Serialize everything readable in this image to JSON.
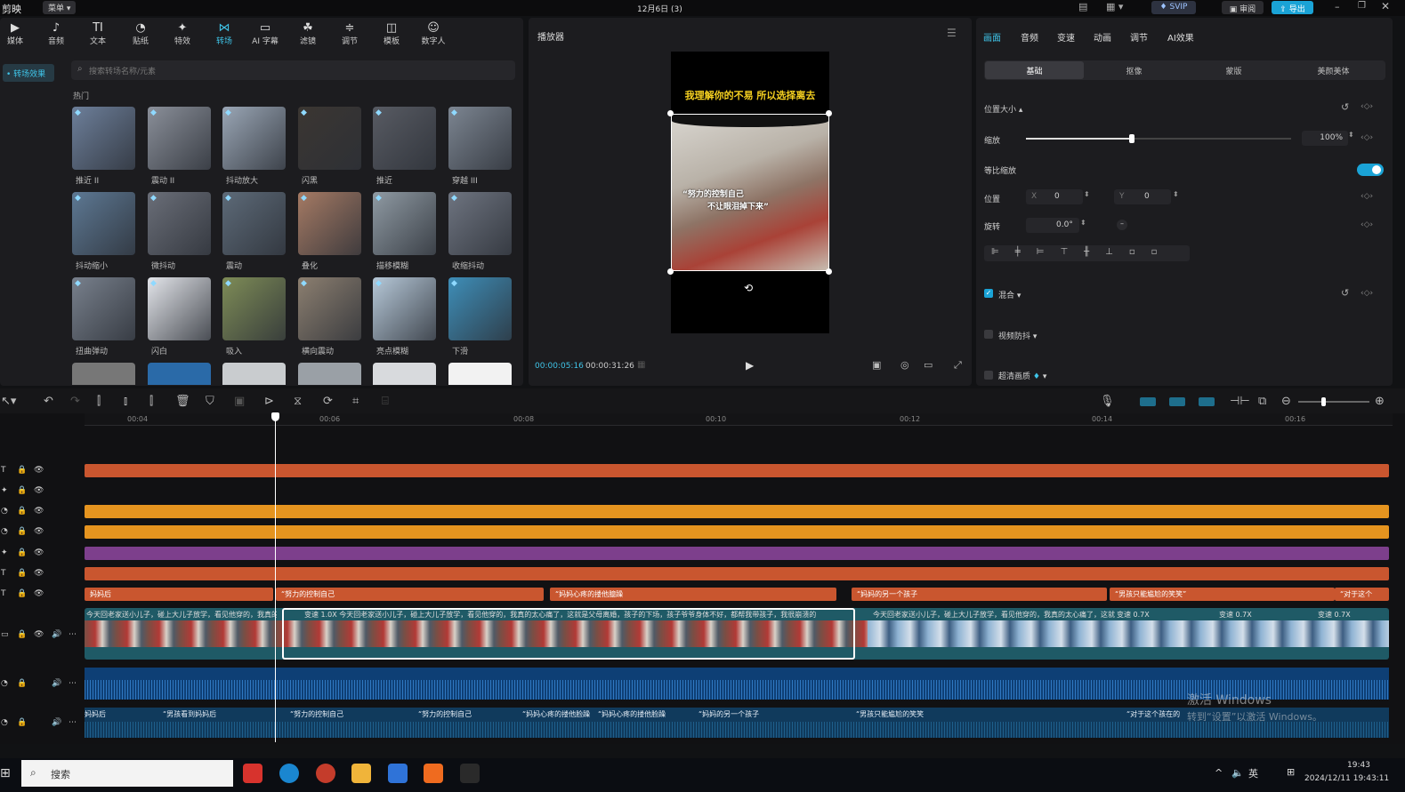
{
  "app": {
    "title": "剪映",
    "menu": "菜单",
    "project_title": "12月6日 (3)",
    "svip": "SVIP",
    "review": "审阅",
    "export": "导出"
  },
  "top_tabs": [
    {
      "label": "媒体",
      "icon": "▶"
    },
    {
      "label": "音频",
      "icon": "♪"
    },
    {
      "label": "文本",
      "icon": "TI"
    },
    {
      "label": "贴纸",
      "icon": "◔"
    },
    {
      "label": "特效",
      "icon": "✦"
    },
    {
      "label": "转场",
      "icon": "⋈"
    },
    {
      "label": "AI 字幕",
      "icon": "▭"
    },
    {
      "label": "滤镜",
      "icon": "☘"
    },
    {
      "label": "调节",
      "icon": "≑"
    },
    {
      "label": "模板",
      "icon": "◫"
    },
    {
      "label": "数字人",
      "icon": "☺"
    }
  ],
  "left": {
    "category": "• 转场效果",
    "search_placeholder": "搜索转场名称/元素",
    "section": "热门",
    "items": [
      {
        "label": "推近 II",
        "color": "#6d7f9a"
      },
      {
        "label": "震动 II",
        "color": "#8a8f99"
      },
      {
        "label": "抖动放大",
        "color": "#9aa6b5"
      },
      {
        "label": "闪黑",
        "color": "#3b3632"
      },
      {
        "label": "推近",
        "color": "#585b63"
      },
      {
        "label": "穿越 III",
        "color": "#7c8591"
      },
      {
        "label": "抖动缩小",
        "color": "#5d7893"
      },
      {
        "label": "微抖动",
        "color": "#6a6e78"
      },
      {
        "label": "震动",
        "color": "#5d6a78"
      },
      {
        "label": "叠化",
        "color": "#a57a64"
      },
      {
        "label": "描移模糊",
        "color": "#8f9aa3"
      },
      {
        "label": "收缩抖动",
        "color": "#6e7480"
      },
      {
        "label": "扭曲弹动",
        "color": "#78808c"
      },
      {
        "label": "闪白",
        "color": "#e3e5ea"
      },
      {
        "label": "吸入",
        "color": "#7e8c57"
      },
      {
        "label": "横向震动",
        "color": "#8c7f70"
      },
      {
        "label": "亮点模糊",
        "color": "#b6c8d8"
      },
      {
        "label": "下滑",
        "color": "#3e8eb8"
      }
    ]
  },
  "player": {
    "title": "播放器",
    "caption_top": "我理解你的不易 所以选择离去",
    "caption_mid_1": "“努力的控制自己",
    "caption_mid_2": "不让眼泪掉下来”",
    "time_current": "00:00:05:16",
    "time_total": "00:00:31:26"
  },
  "right": {
    "tabs": [
      "画面",
      "音频",
      "变速",
      "动画",
      "调节",
      "AI效果"
    ],
    "subtabs": [
      "基础",
      "抠像",
      "蒙版",
      "美颜美体"
    ],
    "section_position": "位置大小",
    "scale_label": "缩放",
    "scale_value": "100%",
    "scale_fraction": 0.4,
    "uniform_label": "等比缩放",
    "position_label": "位置",
    "x_label": "X",
    "x_value": "0",
    "y_label": "Y",
    "y_value": "0",
    "rotate_label": "旋转",
    "rotate_value": "0.0°",
    "blend_label": "混合",
    "stabilize_label": "视频防抖",
    "hd_label": "超清画质"
  },
  "timeline": {
    "ruler": [
      "00:04",
      "00:06",
      "00:08",
      "00:10",
      "00:12",
      "00:14",
      "00:16"
    ],
    "text_clips": [
      {
        "label": "妈妈后"
      },
      {
        "label": "“努力的控制自己"
      },
      {
        "label": "“妈妈心疼的搂他臆躁"
      },
      {
        "label": "“妈妈的另一个孩子"
      },
      {
        "label": "“男孩只能尴尬的笑笑”"
      },
      {
        "label": "“对于这个"
      }
    ],
    "video_caption": "今天回老家送小儿子，碰上大儿子放学，看见他穿的，我真的太心痛了，这就是父母离婚，孩子的下场，孩子爷爷身体不好，都帮我带孩子，我很崩溃的",
    "speed_1": "变速 1.0X",
    "speed_2": "变速 0.7X",
    "speed_3": "变速 0.7X",
    "speed_4": "变速 0.7X",
    "audio_clips": [
      {
        "label": "妈妈后"
      },
      {
        "label": "“男孩看到妈妈后"
      },
      {
        "label": "“努力的控制自己"
      },
      {
        "label": "“努力的控制自己"
      },
      {
        "label": "“妈妈心疼的搂他脸躁"
      },
      {
        "label": "“妈妈心疼的搂他脸躁"
      },
      {
        "label": "“妈妈的另一个孩子"
      },
      {
        "label": "“男孩只能尴尬的笑笑"
      },
      {
        "label": "“对于这个孩在的"
      }
    ]
  },
  "watermark": {
    "line1": "激活 Windows",
    "line2": "转到“设置”以激活 Windows。"
  },
  "taskbar": {
    "search": "搜索",
    "lang": "英",
    "time": "19:43",
    "date": "2024/12/11 19:43:11"
  }
}
